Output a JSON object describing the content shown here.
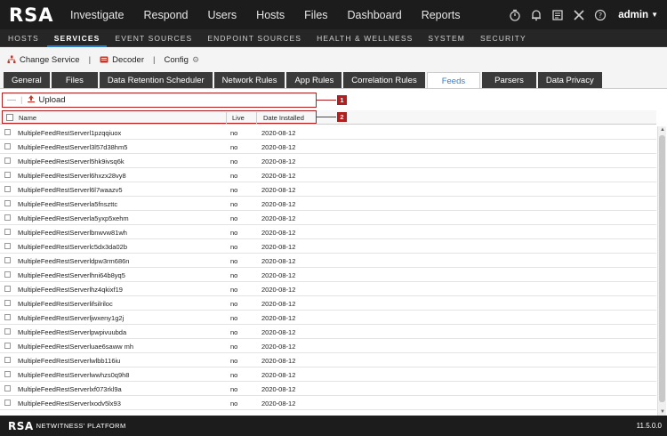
{
  "topbar": {
    "logo": "RSA",
    "nav": [
      "Investigate",
      "Respond",
      "Users",
      "Hosts",
      "Files",
      "Dashboard",
      "Reports"
    ],
    "icons": [
      "timer-icon",
      "bell-icon",
      "tasks-icon",
      "tools-icon",
      "help-icon"
    ],
    "user": "admin"
  },
  "subnav": {
    "items": [
      "HOSTS",
      "SERVICES",
      "EVENT SOURCES",
      "ENDPOINT SOURCES",
      "HEALTH & WELLNESS",
      "SYSTEM",
      "SECURITY"
    ],
    "active": "SERVICES"
  },
  "servicebar": {
    "change_service": "Change Service",
    "service_name": "Decoder",
    "config": "Config"
  },
  "tabs": {
    "items": [
      "General",
      "Files",
      "Data Retention Scheduler",
      "Network Rules",
      "App Rules",
      "Correlation Rules",
      "Feeds",
      "Parsers",
      "Data Privacy"
    ],
    "active": "Feeds"
  },
  "toolbar": {
    "minus": "—",
    "upload": "Upload"
  },
  "markers": {
    "m1": "1",
    "m2": "2"
  },
  "table": {
    "columns": {
      "name": "Name",
      "live": "Live",
      "date": "Date Installed"
    },
    "rows": [
      {
        "name": "MultipleFeedRestServerl1pzqqiuox",
        "live": "no",
        "date": "2020-08-12"
      },
      {
        "name": "MultipleFeedRestServerl3l57d38hm5",
        "live": "no",
        "date": "2020-08-12"
      },
      {
        "name": "MultipleFeedRestServerl5hk9ivsq6k",
        "live": "no",
        "date": "2020-08-12"
      },
      {
        "name": "MultipleFeedRestServerl6hxzx28vy8",
        "live": "no",
        "date": "2020-08-12"
      },
      {
        "name": "MultipleFeedRestServerl6l7waazv5",
        "live": "no",
        "date": "2020-08-12"
      },
      {
        "name": "MultipleFeedRestServerla5fnszttc",
        "live": "no",
        "date": "2020-08-12"
      },
      {
        "name": "MultipleFeedRestServerla5yxp5xehm",
        "live": "no",
        "date": "2020-08-12"
      },
      {
        "name": "MultipleFeedRestServerlbnwvw81wh",
        "live": "no",
        "date": "2020-08-12"
      },
      {
        "name": "MultipleFeedRestServerlc5dx3da02b",
        "live": "no",
        "date": "2020-08-12"
      },
      {
        "name": "MultipleFeedRestServerldpw3rm686n",
        "live": "no",
        "date": "2020-08-12"
      },
      {
        "name": "MultipleFeedRestServerlhni64b8yq5",
        "live": "no",
        "date": "2020-08-12"
      },
      {
        "name": "MultipleFeedRestServerlhz4qkixf19",
        "live": "no",
        "date": "2020-08-12"
      },
      {
        "name": "MultipleFeedRestServerlifsilriloc",
        "live": "no",
        "date": "2020-08-12"
      },
      {
        "name": "MultipleFeedRestServerljwxeny1g2j",
        "live": "no",
        "date": "2020-08-12"
      },
      {
        "name": "MultipleFeedRestServerlpwpivuubda",
        "live": "no",
        "date": "2020-08-12"
      },
      {
        "name": "MultipleFeedRestServerluae6saww mh",
        "live": "no",
        "date": "2020-08-12"
      },
      {
        "name": "MultipleFeedRestServerlwlbb116iu",
        "live": "no",
        "date": "2020-08-12"
      },
      {
        "name": "MultipleFeedRestServerlwwhzs0q9h8",
        "live": "no",
        "date": "2020-08-12"
      },
      {
        "name": "MultipleFeedRestServerlxf073rkl9a",
        "live": "no",
        "date": "2020-08-12"
      },
      {
        "name": "MultipleFeedRestServerlxodv5lx93",
        "live": "no",
        "date": "2020-08-12"
      }
    ]
  },
  "footer": {
    "logo": "RSA",
    "brand": "NETWITNESS' PLATFORM",
    "version": "11.5.0.0"
  },
  "colors": {
    "accent": "#2a7fd4",
    "highlight": "#b02020",
    "topbar_bg": "#1c1c1c"
  }
}
